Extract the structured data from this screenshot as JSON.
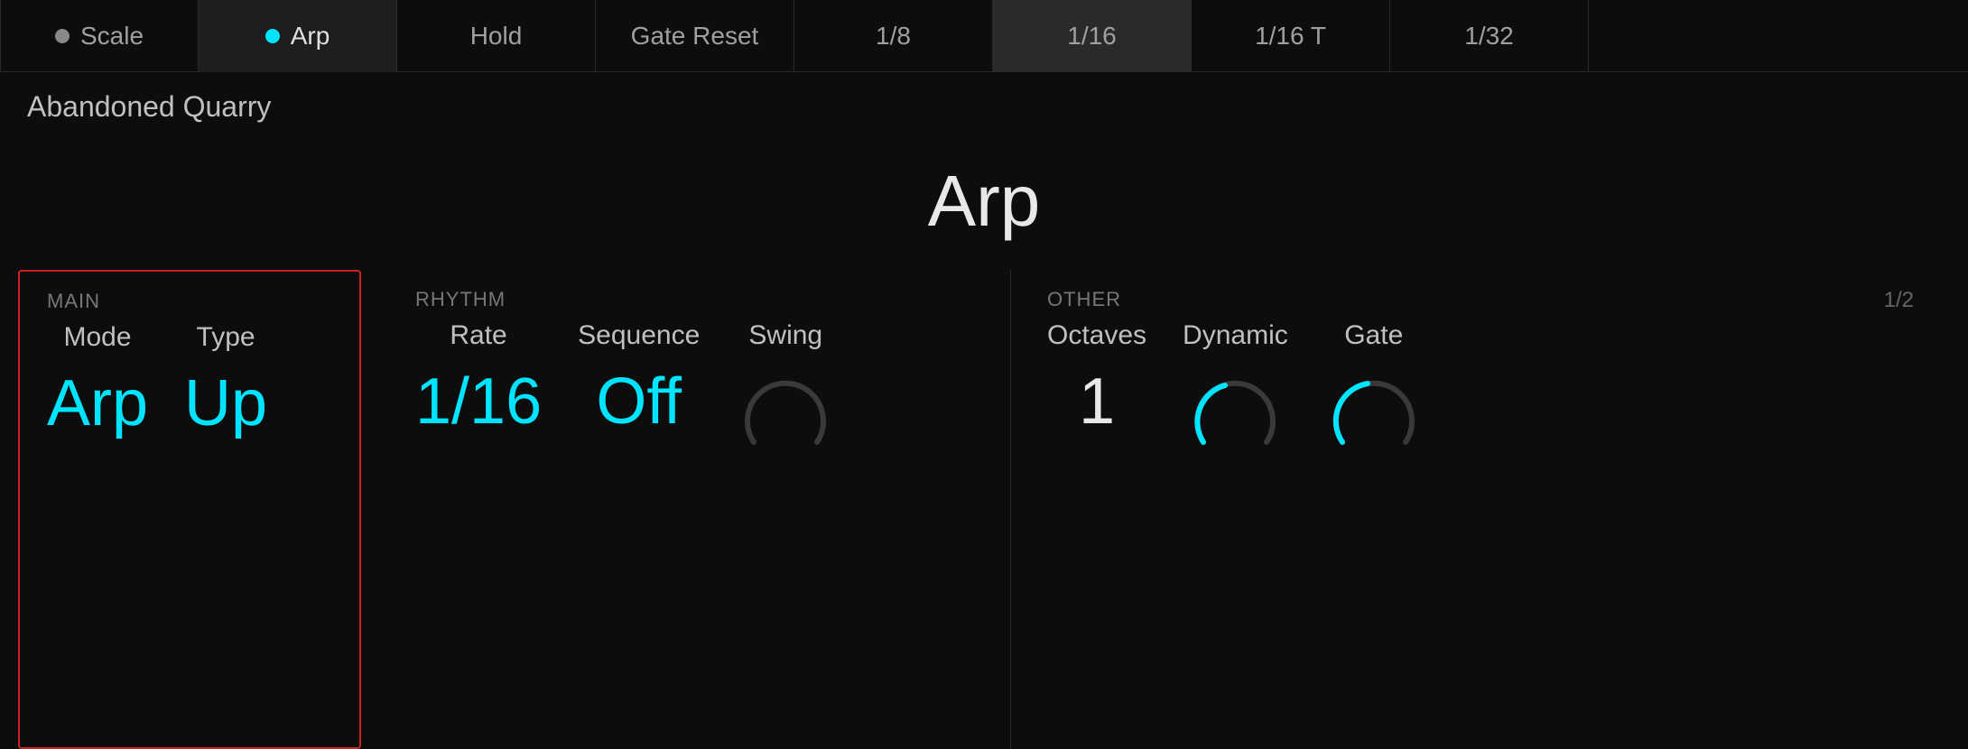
{
  "nav": {
    "items": [
      {
        "label": "Scale",
        "dot": true,
        "dotColor": "gray",
        "active": false,
        "id": "scale"
      },
      {
        "label": "Arp",
        "dot": true,
        "dotColor": "cyan",
        "active": true,
        "id": "arp"
      },
      {
        "label": "Hold",
        "dot": false,
        "active": false,
        "id": "hold"
      },
      {
        "label": "Gate Reset",
        "dot": false,
        "active": false,
        "id": "gate-reset"
      },
      {
        "label": "1/8",
        "dot": false,
        "active": false,
        "id": "rate-eighth"
      },
      {
        "label": "1/16",
        "dot": false,
        "active": true,
        "id": "rate-sixteenth"
      },
      {
        "label": "1/16 T",
        "dot": false,
        "active": false,
        "id": "rate-sixteenth-t"
      },
      {
        "label": "1/32",
        "dot": false,
        "active": false,
        "id": "rate-thirtysecond"
      }
    ]
  },
  "preset_name": "Abandoned Quarry",
  "arp_title": "Arp",
  "sections": {
    "main": {
      "label": "MAIN",
      "controls": [
        {
          "label": "Mode",
          "value": "Arp",
          "type": "value"
        },
        {
          "label": "Type",
          "value": "Up",
          "type": "value"
        }
      ]
    },
    "rhythm": {
      "label": "RHYTHM",
      "controls": [
        {
          "label": "Rate",
          "value": "1/16",
          "type": "value"
        },
        {
          "label": "Sequence",
          "value": "Off",
          "type": "value"
        },
        {
          "label": "Swing",
          "type": "knob",
          "arc_color": "#444",
          "arc_value": 0
        }
      ]
    },
    "other": {
      "label": "OTHER",
      "page": "1/2",
      "controls": [
        {
          "label": "Octaves",
          "value": "1",
          "type": "value"
        },
        {
          "label": "Dynamic",
          "type": "knob",
          "arc_color": "#00e5ff",
          "arc_value": 0.35
        },
        {
          "label": "Gate",
          "type": "knob",
          "arc_color": "#00e5ff",
          "arc_value": 0.4
        }
      ]
    }
  },
  "icons": {
    "dot_gray": "●",
    "dot_cyan": "●"
  }
}
